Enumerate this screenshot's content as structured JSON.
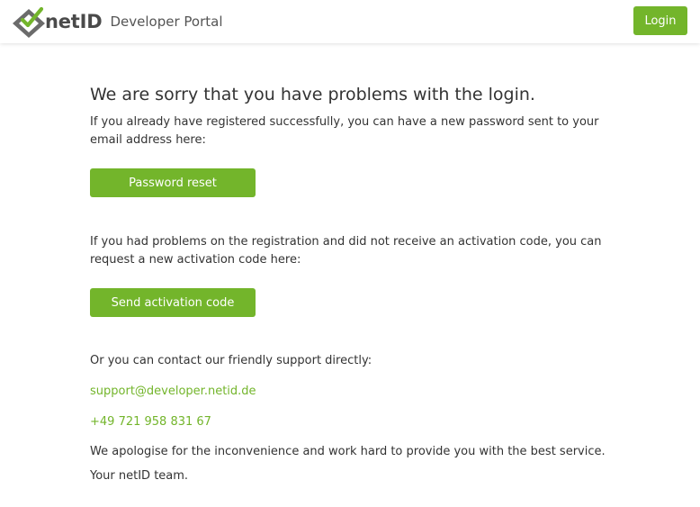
{
  "header": {
    "brand": "netID",
    "subtitle": "Developer Portal",
    "login_label": "Login",
    "logo_icon": "netid-checkmark-logo-icon"
  },
  "main": {
    "title": "We are sorry that you have problems with the login.",
    "password_intro": "If you already have registered successfully, you can have a new password sent to your email address here:",
    "password_reset_label": "Password reset",
    "activation_intro": "If you had problems on the registration and did not receive an activation code, you can request a new activation code here:",
    "send_activation_label": "Send activation code",
    "support_intro": "Or you can contact our friendly support directly:",
    "support_email": "support@developer.netid.de",
    "support_phone": "+49 721 958 831 67",
    "apology": "We apologise for the inconvenience and work hard to provide you with the best service.",
    "signoff": "Your netID team."
  },
  "colors": {
    "accent": "#73b52b",
    "text": "#333333",
    "logo_gray": "#666666"
  }
}
